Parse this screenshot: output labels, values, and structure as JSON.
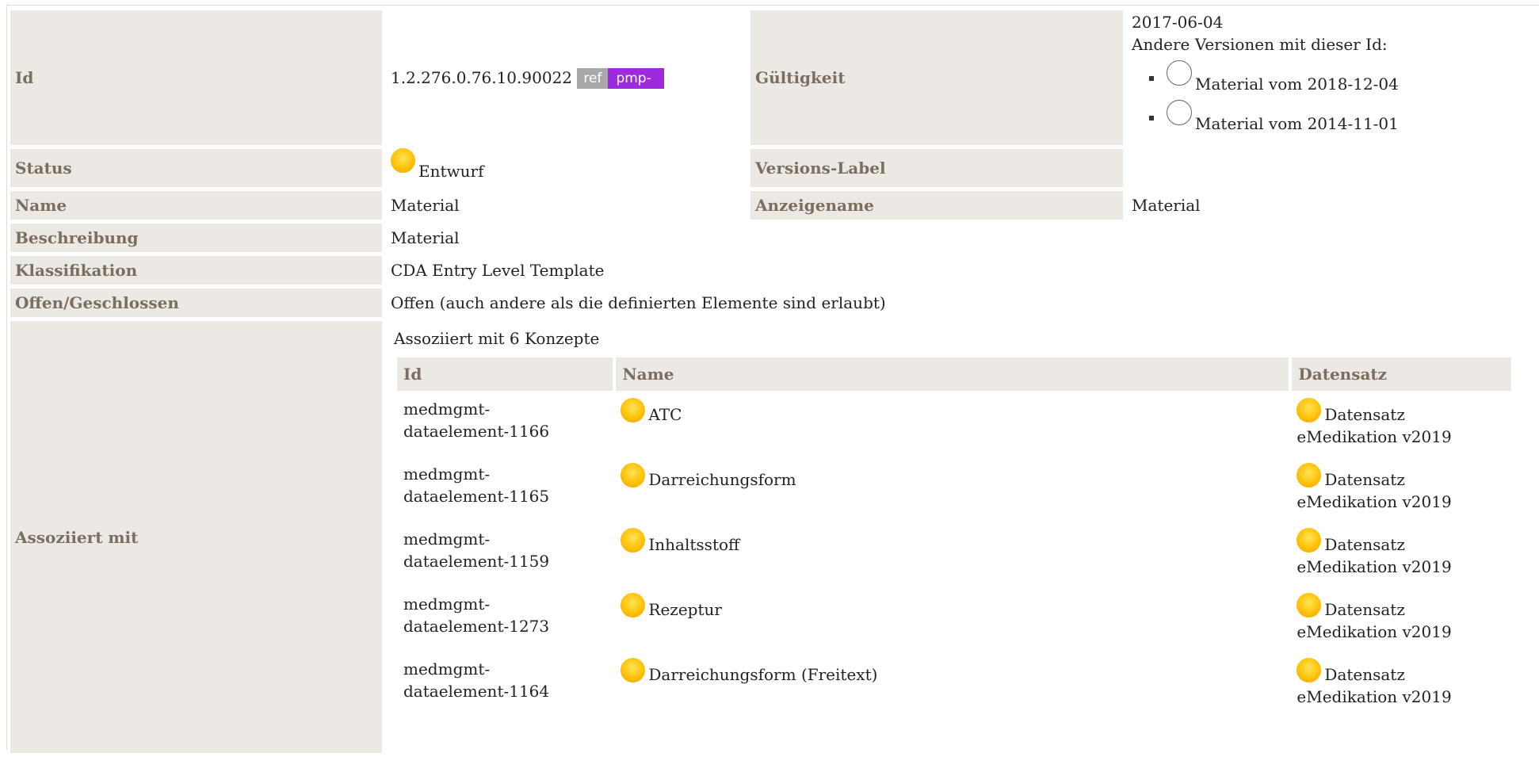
{
  "rows": {
    "id": {
      "label": "Id",
      "value": "1.2.276.0.76.10.90022",
      "badge_ref": "ref",
      "badge_pmp": "pmp-"
    },
    "gueltigkeit": {
      "label": "Gültigkeit",
      "date": "2017-06-04",
      "other_versions_label": "Andere Versionen mit dieser Id:",
      "versions": [
        "Material vom 2018-12-04",
        "Material vom 2014-11-01"
      ]
    },
    "status": {
      "label": "Status",
      "value": "Entwurf",
      "status_color": "#ffc107"
    },
    "versions_label": {
      "label": "Versions-Label",
      "value": ""
    },
    "name": {
      "label": "Name",
      "value": "Material"
    },
    "anzeigename": {
      "label": "Anzeigename",
      "value": "Material"
    },
    "beschreibung": {
      "label": "Beschreibung",
      "value": "Material"
    },
    "klassifikation": {
      "label": "Klassifikation",
      "value": "CDA Entry Level Template"
    },
    "offen": {
      "label": "Offen/Geschlossen",
      "value": "Offen (auch andere als die definierten Elemente sind erlaubt)"
    },
    "assoziiert": {
      "label": "Assoziiert mit",
      "heading": "Assoziiert mit 6 Konzepte",
      "columns": {
        "id": "Id",
        "name": "Name",
        "datensatz": "Datensatz"
      },
      "concepts": [
        {
          "id_line1": "medmgmt-",
          "id_line2": "dataelement-1166",
          "name": "ATC",
          "ds_line1": "Datensatz",
          "ds_line2": "eMedikation v2019"
        },
        {
          "id_line1": "medmgmt-",
          "id_line2": "dataelement-1165",
          "name": "Darreichungsform",
          "ds_line1": "Datensatz",
          "ds_line2": "eMedikation v2019"
        },
        {
          "id_line1": "medmgmt-",
          "id_line2": "dataelement-1159",
          "name": "Inhaltsstoff",
          "ds_line1": "Datensatz",
          "ds_line2": "eMedikation v2019"
        },
        {
          "id_line1": "medmgmt-",
          "id_line2": "dataelement-1273",
          "name": "Rezeptur",
          "ds_line1": "Datensatz",
          "ds_line2": "eMedikation v2019"
        },
        {
          "id_line1": "medmgmt-",
          "id_line2": "dataelement-1164",
          "name": "Darreichungsform (Freitext)",
          "ds_line1": "Datensatz",
          "ds_line2": "eMedikation v2019"
        }
      ]
    }
  },
  "colors": {
    "label_bg": "#ece9e4",
    "label_text": "#7a6e60",
    "badge_ref": "#a8a8a8",
    "badge_pmp": "#9b2bdc",
    "status_dot": "#ffc107"
  }
}
